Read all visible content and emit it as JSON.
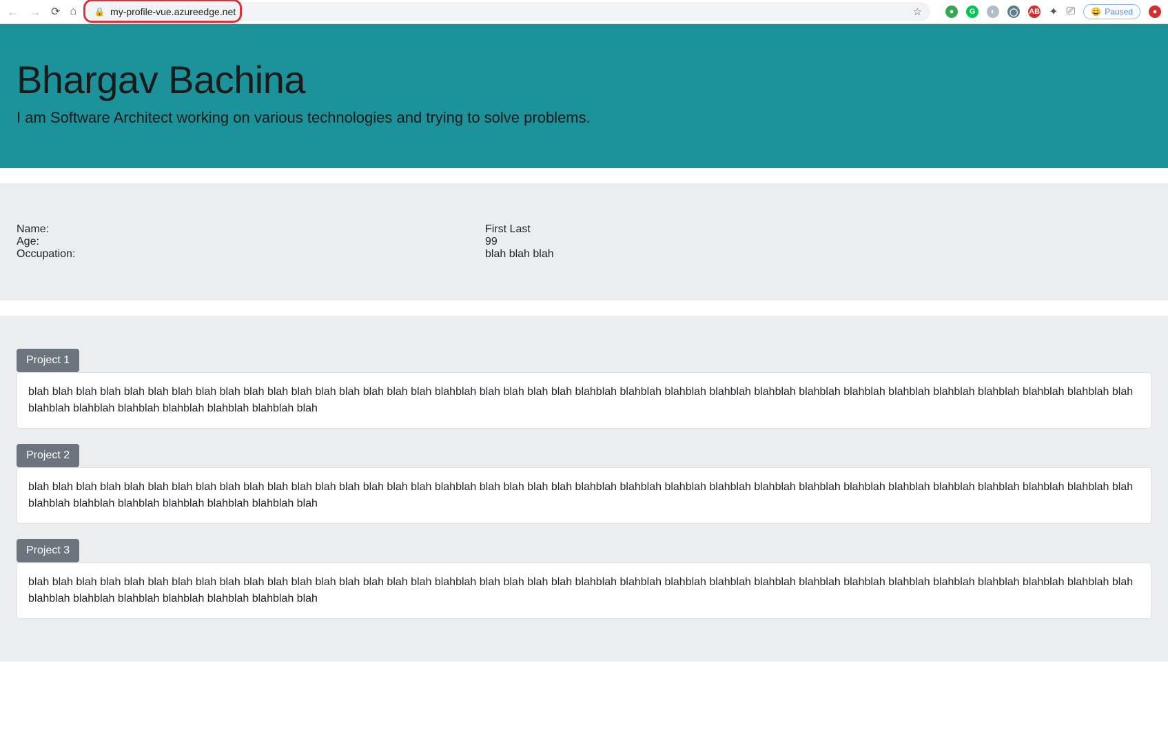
{
  "browser": {
    "url": "my-profile-vue.azureedge.net",
    "paused_label": "Paused"
  },
  "hero": {
    "title": "Bhargav Bachina",
    "subtitle": "I am Software Architect working on various technologies and trying to solve problems."
  },
  "info": {
    "rows": [
      {
        "label": "Name:",
        "value": "First Last"
      },
      {
        "label": "Age:",
        "value": "99"
      },
      {
        "label": "Occupation:",
        "value": "blah blah blah"
      }
    ]
  },
  "projects": [
    {
      "title": "Project 1",
      "body": "blah blah blah blah blah blah blah blah blah blah blah blah blah blah blah blah blah blahblah blah blah blah blah blahblah blahblah blahblah blahblah blahblah blahblah blahblah blahblah blahblah blahblah blahblah blahblah blah blahblah blahblah blahblah blahblah blahblah blahblah blah"
    },
    {
      "title": "Project 2",
      "body": "blah blah blah blah blah blah blah blah blah blah blah blah blah blah blah blah blah blahblah blah blah blah blah blahblah blahblah blahblah blahblah blahblah blahblah blahblah blahblah blahblah blahblah blahblah blahblah blah blahblah blahblah blahblah blahblah blahblah blahblah blah"
    },
    {
      "title": "Project 3",
      "body": "blah blah blah blah blah blah blah blah blah blah blah blah blah blah blah blah blah blahblah blah blah blah blah blahblah blahblah blahblah blahblah blahblah blahblah blahblah blahblah blahblah blahblah blahblah blahblah blah blahblah blahblah blahblah blahblah blahblah blahblah blah"
    }
  ]
}
